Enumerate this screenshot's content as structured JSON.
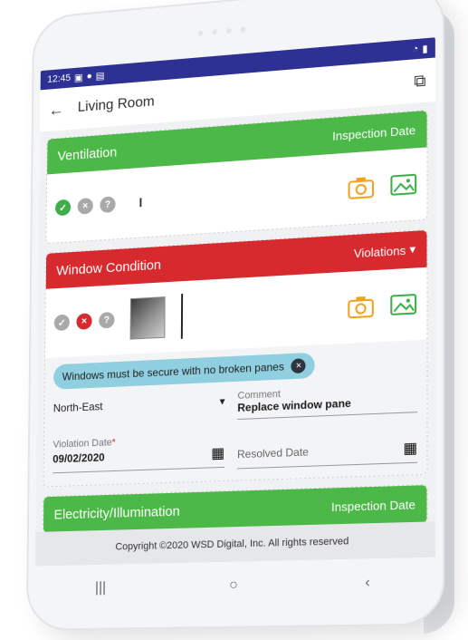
{
  "status_bar": {
    "time": "12:45",
    "left_icons": [
      "image-icon",
      "circle-icon",
      "card-icon"
    ],
    "right_icons": [
      "wifi-icon",
      "battery-icon"
    ]
  },
  "header": {
    "title": "Living Room"
  },
  "cards": [
    {
      "title": "Ventilation",
      "right_label": "Inspection Date",
      "color": "#4cb848"
    },
    {
      "title": "Window Condition",
      "right_label": "Violations",
      "color": "#d72a2f",
      "chip_text": "Windows must be secure with no broken panes",
      "location": "North-East",
      "comment_label": "Comment",
      "comment_value": "Replace window pane",
      "violation_date_label": "Violation Date",
      "violation_date_value": "09/02/2020",
      "resolved_date_label": "Resolved Date"
    },
    {
      "title": "Electricity/Illumination",
      "right_label": "Inspection Date",
      "color": "#4cb848"
    }
  ],
  "footer": {
    "copyright": "Copyright ©2020 WSD Digital, Inc. All rights reserved"
  },
  "colors": {
    "status_bar": "#2d3194",
    "green": "#4cb848",
    "red": "#d72a2f",
    "chip": "#8fcfe0"
  }
}
